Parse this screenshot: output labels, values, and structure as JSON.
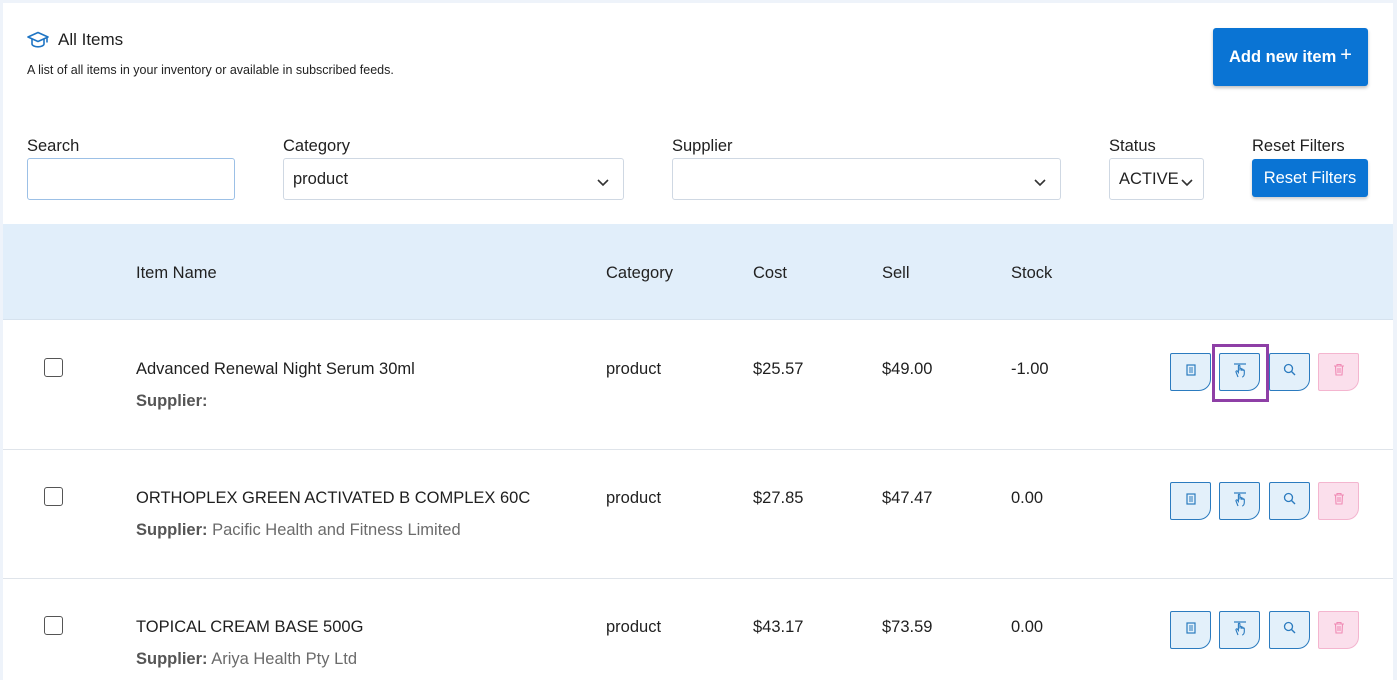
{
  "header": {
    "title": "All Items",
    "subtitle": "A list of all items in your inventory or available in subscribed feeds.",
    "add_button": "Add new item",
    "add_button_plus": "+"
  },
  "filters": {
    "search_label": "Search",
    "search_value": "",
    "category_label": "Category",
    "category_value": "product",
    "supplier_label": "Supplier",
    "supplier_value": "",
    "status_label": "Status",
    "status_value": "ACTIVE",
    "reset_label": "Reset Filters",
    "reset_button": "Reset Filters"
  },
  "table": {
    "columns": [
      "Item Name",
      "Category",
      "Cost",
      "Sell",
      "Stock"
    ],
    "supplier_prefix": "Supplier:",
    "rows": [
      {
        "name": "Advanced Renewal Night Serum 30ml",
        "supplier": "",
        "category": "product",
        "cost": "$25.57",
        "sell": "$49.00",
        "stock": "-1.00"
      },
      {
        "name": "ORTHOPLEX GREEN ACTIVATED B COMPLEX 60C",
        "supplier": "Pacific Health and Fitness Limited",
        "category": "product",
        "cost": "$27.85",
        "sell": "$47.47",
        "stock": "0.00"
      },
      {
        "name": "TOPICAL CREAM BASE 500G",
        "supplier": "Ariya Health Pty Ltd",
        "category": "product",
        "cost": "$43.17",
        "sell": "$73.59",
        "stock": "0.00"
      }
    ]
  },
  "icons": {
    "header": "graduation-cap-icon",
    "actions": [
      "document-icon",
      "tap-hand-icon",
      "search-icon",
      "trash-icon"
    ]
  },
  "colors": {
    "primary": "#0a74d4",
    "table_header_bg": "#e1eefa",
    "action_border": "#2b7bbf",
    "delete_bg": "#fbdfec",
    "highlight": "#8e3fa6"
  }
}
